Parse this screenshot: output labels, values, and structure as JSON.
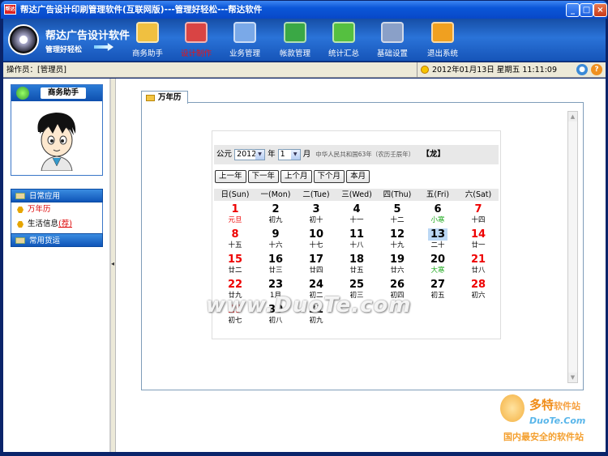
{
  "window": {
    "title": "帮达广告设计印刷管理软件(互联网版)---管理好轻松---帮达软件",
    "app_icon_text": "帮达",
    "minimize": "_",
    "maximize": "□",
    "close": "×"
  },
  "logo": {
    "name": "帮达广告设计软件",
    "slogan": "管理好轻松"
  },
  "toolbar": [
    {
      "label": "商务助手",
      "color": "#f0c040"
    },
    {
      "label": "设计制作",
      "color": "#d94444"
    },
    {
      "label": "业务管理",
      "color": "#7aa9e8"
    },
    {
      "label": "帐款管理",
      "color": "#3aa845"
    },
    {
      "label": "统计汇总",
      "color": "#55c040"
    },
    {
      "label": "基础设置",
      "color": "#8aa0c8"
    },
    {
      "label": "退出系统",
      "color": "#f0a020"
    }
  ],
  "status": {
    "operator": "操作员：[管理员]",
    "date": "2012年01月13日  星期五  11:11:09"
  },
  "left": {
    "biz_title": "商务助手",
    "daily_header": "日常应用",
    "items": [
      {
        "label": "万年历"
      },
      {
        "label": "生活信息",
        "badge": "(荐)"
      }
    ],
    "common_header": "常用货运"
  },
  "tab": {
    "label": "万年历"
  },
  "calendar": {
    "era": "公元",
    "year": "2012",
    "year_unit": "年",
    "month": "1",
    "month_unit": "月",
    "info": "中华人民共和国63年（农历壬辰年）",
    "zodiac": "【龙】",
    "buttons": [
      "上一年",
      "下一年",
      "上个月",
      "下个月",
      "本月"
    ],
    "weekdays": [
      "日(Sun)",
      "一(Mon)",
      "二(Tue)",
      "三(Wed)",
      "四(Thu)",
      "五(Fri)",
      "六(Sat)"
    ],
    "days": [
      {
        "d": "1",
        "l": "元旦",
        "red": true,
        "holi": true
      },
      {
        "d": "2",
        "l": "初九"
      },
      {
        "d": "3",
        "l": "初十"
      },
      {
        "d": "4",
        "l": "十一"
      },
      {
        "d": "5",
        "l": "十二"
      },
      {
        "d": "6",
        "l": "小寒",
        "term": true
      },
      {
        "d": "7",
        "l": "十四",
        "red": true
      },
      {
        "d": "8",
        "l": "十五",
        "red": true
      },
      {
        "d": "9",
        "l": "十六"
      },
      {
        "d": "10",
        "l": "十七"
      },
      {
        "d": "11",
        "l": "十八"
      },
      {
        "d": "12",
        "l": "十九"
      },
      {
        "d": "13",
        "l": "二十",
        "today": true
      },
      {
        "d": "14",
        "l": "廿一",
        "red": true
      },
      {
        "d": "15",
        "l": "廿二",
        "red": true
      },
      {
        "d": "16",
        "l": "廿三"
      },
      {
        "d": "17",
        "l": "廿四"
      },
      {
        "d": "18",
        "l": "廿五"
      },
      {
        "d": "19",
        "l": "廿六"
      },
      {
        "d": "20",
        "l": "大寒",
        "term": true
      },
      {
        "d": "21",
        "l": "廿八",
        "red": true
      },
      {
        "d": "22",
        "l": "廿九",
        "red": true
      },
      {
        "d": "23",
        "l": "1月"
      },
      {
        "d": "24",
        "l": "初二"
      },
      {
        "d": "25",
        "l": "初三"
      },
      {
        "d": "26",
        "l": "初四"
      },
      {
        "d": "27",
        "l": "初五"
      },
      {
        "d": "28",
        "l": "初六",
        "red": true
      },
      {
        "d": "29",
        "l": "初七",
        "red": true
      },
      {
        "d": "30",
        "l": "初八"
      },
      {
        "d": "31",
        "l": "初九"
      }
    ]
  },
  "watermark": "www.DuoTe.com",
  "brand": {
    "cn": "多特",
    "cn_small": "软件站",
    "en": "DuoTe.Com",
    "tagline": "国内最安全的软件站"
  }
}
